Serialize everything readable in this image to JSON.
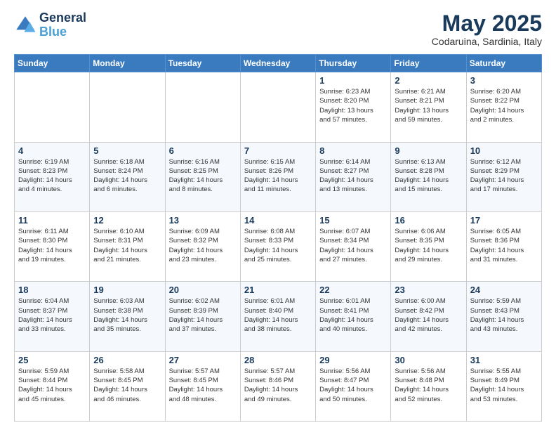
{
  "logo": {
    "line1": "General",
    "line2": "Blue"
  },
  "title": "May 2025",
  "subtitle": "Codaruina, Sardinia, Italy",
  "days_of_week": [
    "Sunday",
    "Monday",
    "Tuesday",
    "Wednesday",
    "Thursday",
    "Friday",
    "Saturday"
  ],
  "weeks": [
    [
      {
        "day": "",
        "info": ""
      },
      {
        "day": "",
        "info": ""
      },
      {
        "day": "",
        "info": ""
      },
      {
        "day": "",
        "info": ""
      },
      {
        "day": "1",
        "info": "Sunrise: 6:23 AM\nSunset: 8:20 PM\nDaylight: 13 hours\nand 57 minutes."
      },
      {
        "day": "2",
        "info": "Sunrise: 6:21 AM\nSunset: 8:21 PM\nDaylight: 13 hours\nand 59 minutes."
      },
      {
        "day": "3",
        "info": "Sunrise: 6:20 AM\nSunset: 8:22 PM\nDaylight: 14 hours\nand 2 minutes."
      }
    ],
    [
      {
        "day": "4",
        "info": "Sunrise: 6:19 AM\nSunset: 8:23 PM\nDaylight: 14 hours\nand 4 minutes."
      },
      {
        "day": "5",
        "info": "Sunrise: 6:18 AM\nSunset: 8:24 PM\nDaylight: 14 hours\nand 6 minutes."
      },
      {
        "day": "6",
        "info": "Sunrise: 6:16 AM\nSunset: 8:25 PM\nDaylight: 14 hours\nand 8 minutes."
      },
      {
        "day": "7",
        "info": "Sunrise: 6:15 AM\nSunset: 8:26 PM\nDaylight: 14 hours\nand 11 minutes."
      },
      {
        "day": "8",
        "info": "Sunrise: 6:14 AM\nSunset: 8:27 PM\nDaylight: 14 hours\nand 13 minutes."
      },
      {
        "day": "9",
        "info": "Sunrise: 6:13 AM\nSunset: 8:28 PM\nDaylight: 14 hours\nand 15 minutes."
      },
      {
        "day": "10",
        "info": "Sunrise: 6:12 AM\nSunset: 8:29 PM\nDaylight: 14 hours\nand 17 minutes."
      }
    ],
    [
      {
        "day": "11",
        "info": "Sunrise: 6:11 AM\nSunset: 8:30 PM\nDaylight: 14 hours\nand 19 minutes."
      },
      {
        "day": "12",
        "info": "Sunrise: 6:10 AM\nSunset: 8:31 PM\nDaylight: 14 hours\nand 21 minutes."
      },
      {
        "day": "13",
        "info": "Sunrise: 6:09 AM\nSunset: 8:32 PM\nDaylight: 14 hours\nand 23 minutes."
      },
      {
        "day": "14",
        "info": "Sunrise: 6:08 AM\nSunset: 8:33 PM\nDaylight: 14 hours\nand 25 minutes."
      },
      {
        "day": "15",
        "info": "Sunrise: 6:07 AM\nSunset: 8:34 PM\nDaylight: 14 hours\nand 27 minutes."
      },
      {
        "day": "16",
        "info": "Sunrise: 6:06 AM\nSunset: 8:35 PM\nDaylight: 14 hours\nand 29 minutes."
      },
      {
        "day": "17",
        "info": "Sunrise: 6:05 AM\nSunset: 8:36 PM\nDaylight: 14 hours\nand 31 minutes."
      }
    ],
    [
      {
        "day": "18",
        "info": "Sunrise: 6:04 AM\nSunset: 8:37 PM\nDaylight: 14 hours\nand 33 minutes."
      },
      {
        "day": "19",
        "info": "Sunrise: 6:03 AM\nSunset: 8:38 PM\nDaylight: 14 hours\nand 35 minutes."
      },
      {
        "day": "20",
        "info": "Sunrise: 6:02 AM\nSunset: 8:39 PM\nDaylight: 14 hours\nand 37 minutes."
      },
      {
        "day": "21",
        "info": "Sunrise: 6:01 AM\nSunset: 8:40 PM\nDaylight: 14 hours\nand 38 minutes."
      },
      {
        "day": "22",
        "info": "Sunrise: 6:01 AM\nSunset: 8:41 PM\nDaylight: 14 hours\nand 40 minutes."
      },
      {
        "day": "23",
        "info": "Sunrise: 6:00 AM\nSunset: 8:42 PM\nDaylight: 14 hours\nand 42 minutes."
      },
      {
        "day": "24",
        "info": "Sunrise: 5:59 AM\nSunset: 8:43 PM\nDaylight: 14 hours\nand 43 minutes."
      }
    ],
    [
      {
        "day": "25",
        "info": "Sunrise: 5:59 AM\nSunset: 8:44 PM\nDaylight: 14 hours\nand 45 minutes."
      },
      {
        "day": "26",
        "info": "Sunrise: 5:58 AM\nSunset: 8:45 PM\nDaylight: 14 hours\nand 46 minutes."
      },
      {
        "day": "27",
        "info": "Sunrise: 5:57 AM\nSunset: 8:45 PM\nDaylight: 14 hours\nand 48 minutes."
      },
      {
        "day": "28",
        "info": "Sunrise: 5:57 AM\nSunset: 8:46 PM\nDaylight: 14 hours\nand 49 minutes."
      },
      {
        "day": "29",
        "info": "Sunrise: 5:56 AM\nSunset: 8:47 PM\nDaylight: 14 hours\nand 50 minutes."
      },
      {
        "day": "30",
        "info": "Sunrise: 5:56 AM\nSunset: 8:48 PM\nDaylight: 14 hours\nand 52 minutes."
      },
      {
        "day": "31",
        "info": "Sunrise: 5:55 AM\nSunset: 8:49 PM\nDaylight: 14 hours\nand 53 minutes."
      }
    ]
  ]
}
